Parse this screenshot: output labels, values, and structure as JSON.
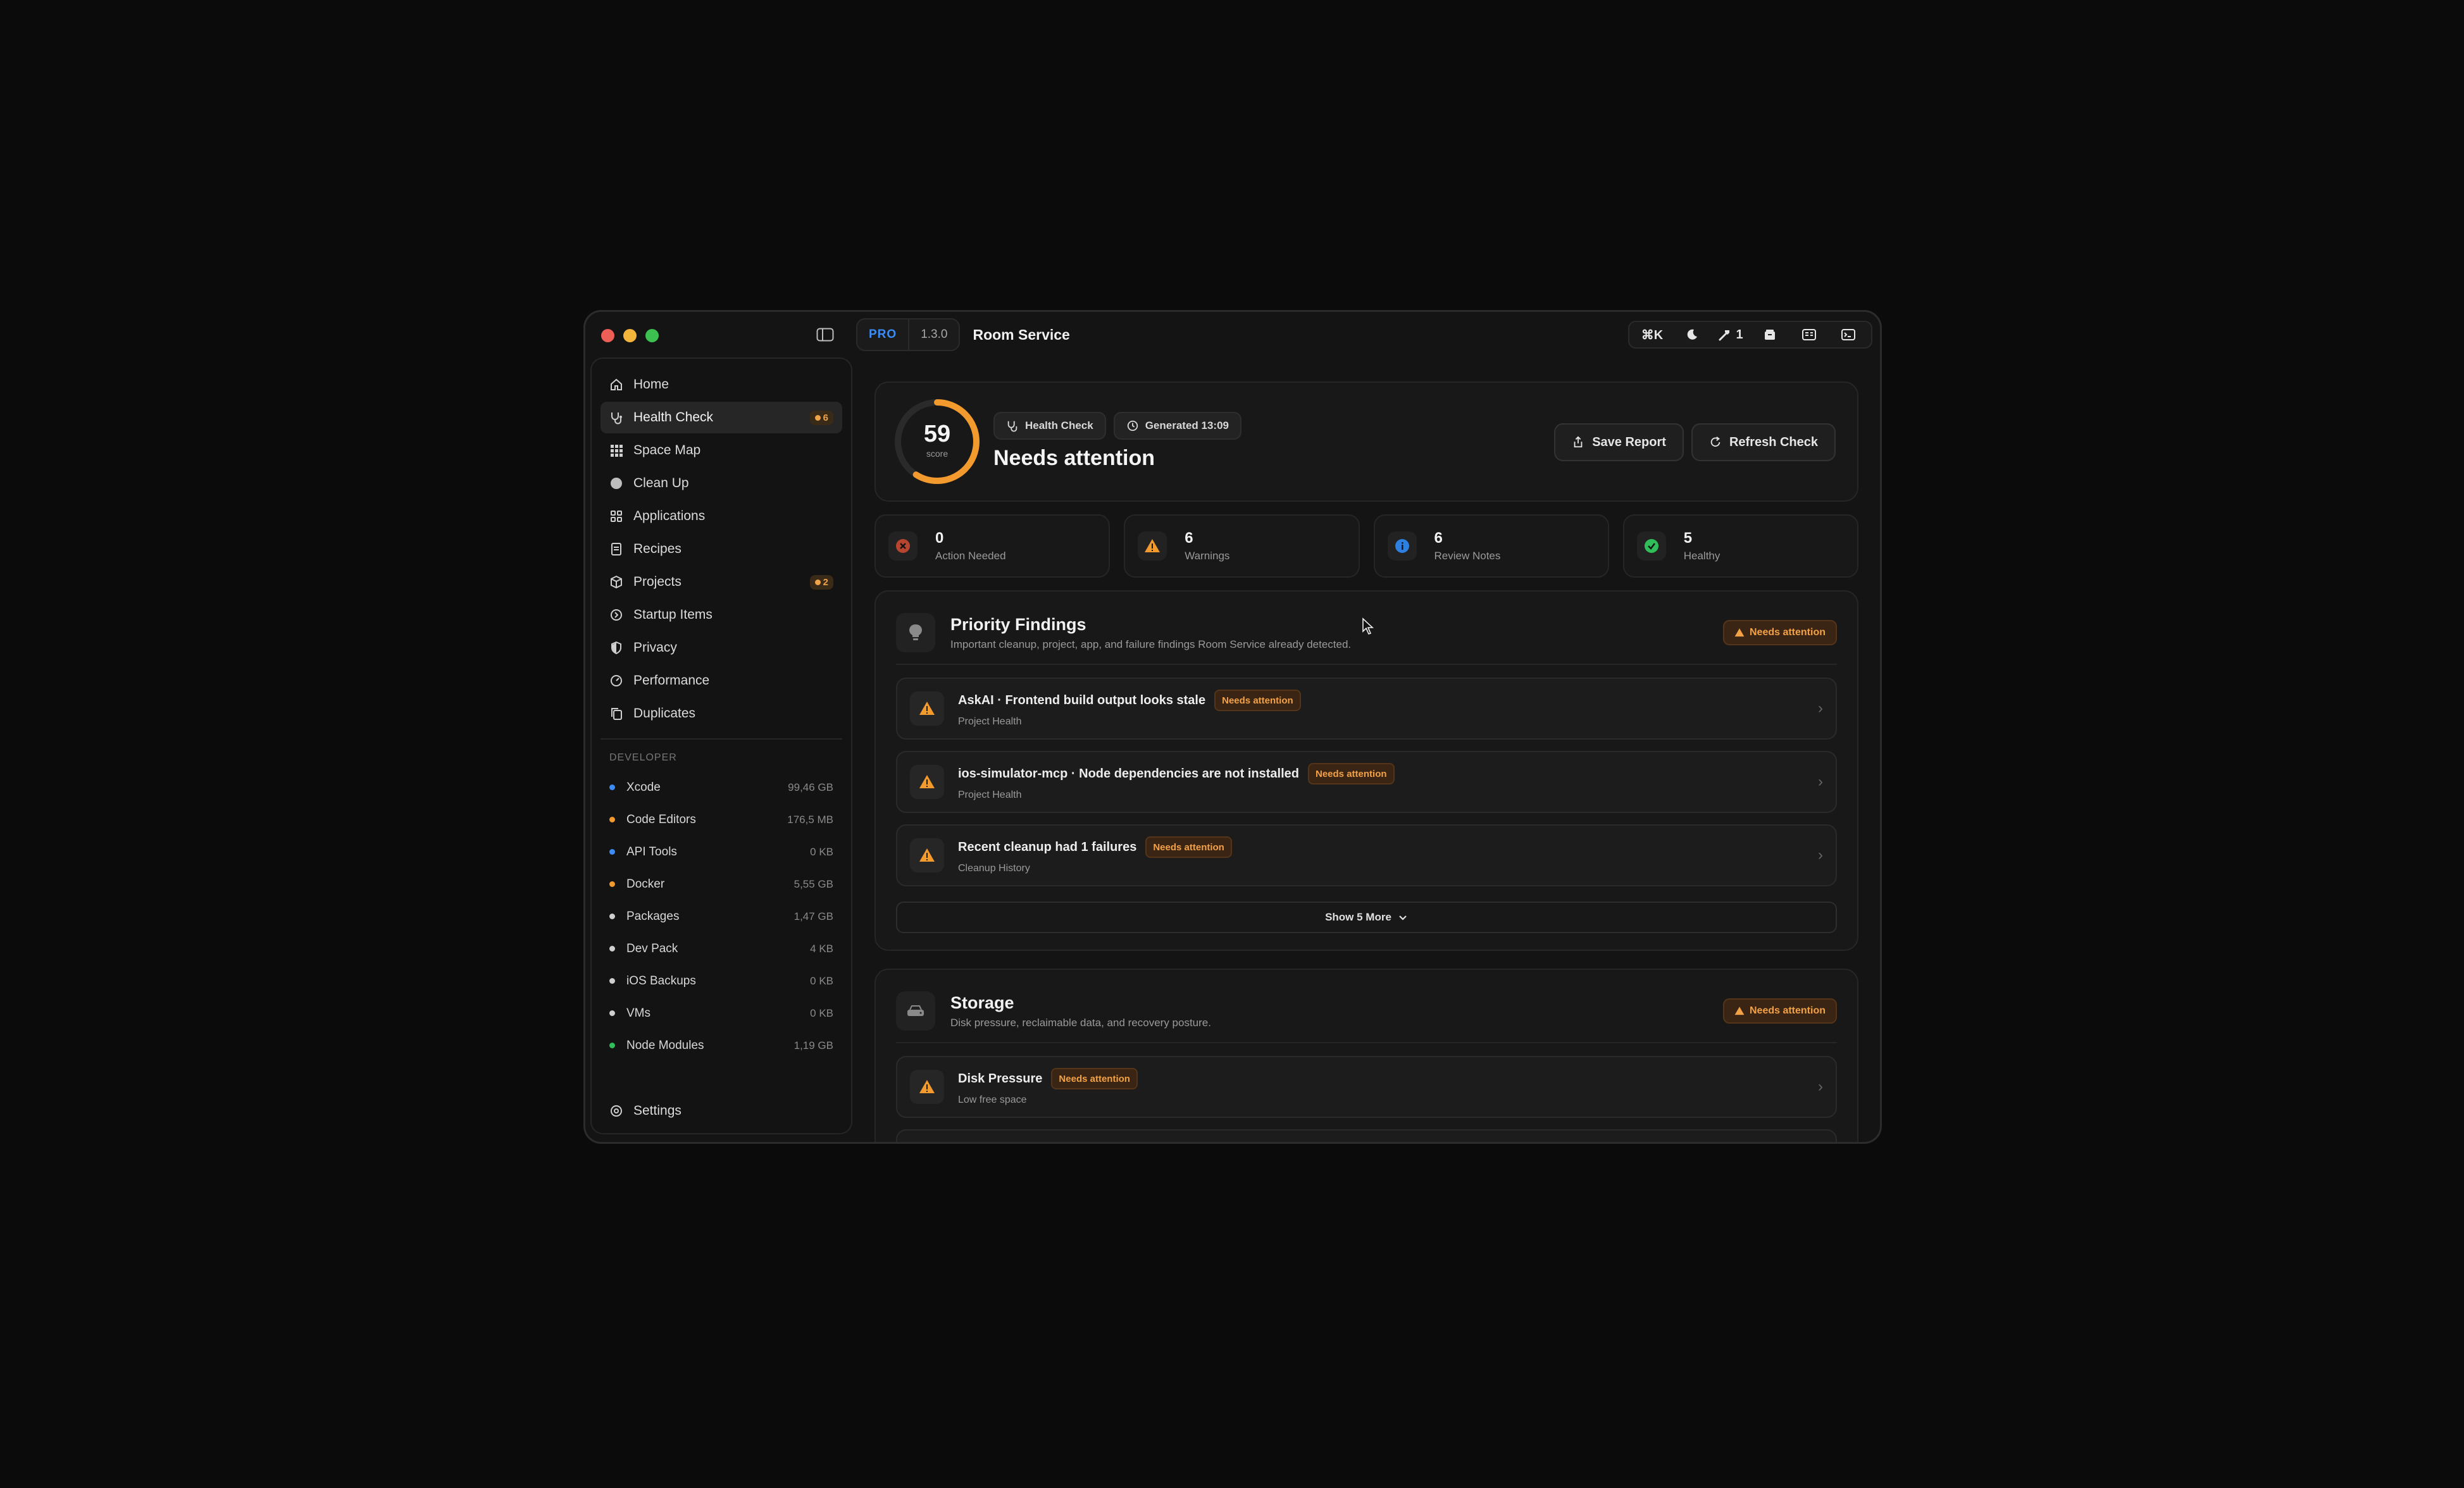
{
  "app": {
    "title": "Room Service",
    "plan": "PRO",
    "version": "1.3.0",
    "colors": {
      "accent": "#3b8df5",
      "warning": "#f29a2e",
      "danger": "#e0523b",
      "success": "#2fbe5a"
    }
  },
  "toolbar": {
    "command_key": "⌘K",
    "mode_icon": "moon-icon",
    "tasks_count": "1"
  },
  "sidebar": {
    "nav": [
      {
        "label": "Home",
        "icon": "home-icon"
      },
      {
        "label": "Health Check",
        "icon": "health-icon",
        "badge": "6",
        "active": true
      },
      {
        "label": "Space Map",
        "icon": "grid-icon"
      },
      {
        "label": "Clean Up",
        "icon": "circle-icon"
      },
      {
        "label": "Applications",
        "icon": "apps-icon"
      },
      {
        "label": "Recipes",
        "icon": "document-icon"
      },
      {
        "label": "Projects",
        "icon": "box-icon",
        "badge": "2"
      },
      {
        "label": "Startup Items",
        "icon": "power-icon"
      },
      {
        "label": "Privacy",
        "icon": "shield-icon"
      },
      {
        "label": "Performance",
        "icon": "gauge-icon"
      },
      {
        "label": "Duplicates",
        "icon": "copy-icon"
      }
    ],
    "developer_heading": "DEVELOPER",
    "developer": [
      {
        "label": "Xcode",
        "size": "99,46 GB",
        "color": "#3b8df5"
      },
      {
        "label": "Code Editors",
        "size": "176,5 MB",
        "color": "#f29a2e"
      },
      {
        "label": "API Tools",
        "size": "0 KB",
        "color": "#3b8df5"
      },
      {
        "label": "Docker",
        "size": "5,55 GB",
        "color": "#f29a2e"
      },
      {
        "label": "Packages",
        "size": "1,47 GB",
        "color": "#cfcfcf"
      },
      {
        "label": "Dev Pack",
        "size": "4 KB",
        "color": "#cfcfcf"
      },
      {
        "label": "iOS Backups",
        "size": "0 KB",
        "color": "#cfcfcf"
      },
      {
        "label": "VMs",
        "size": "0 KB",
        "color": "#cfcfcf"
      },
      {
        "label": "Node Modules",
        "size": "1,19 GB",
        "color": "#2fbe5a"
      }
    ],
    "settings_label": "Settings"
  },
  "hero": {
    "score": "59",
    "score_label": "score",
    "score_fraction": 0.59,
    "chip_health": "Health Check",
    "chip_generated": "Generated 13:09",
    "status": "Needs attention",
    "save_label": "Save Report",
    "refresh_label": "Refresh Check"
  },
  "stats": [
    {
      "value": "0",
      "label": "Action Needed",
      "icon": "x-circle-icon"
    },
    {
      "value": "6",
      "label": "Warnings",
      "icon": "warning-icon"
    },
    {
      "value": "6",
      "label": "Review Notes",
      "icon": "info-icon"
    },
    {
      "value": "5",
      "label": "Healthy",
      "icon": "check-badge-icon"
    }
  ],
  "priority": {
    "title": "Priority Findings",
    "subtitle": "Important cleanup, project, app, and failure findings Room Service already detected.",
    "status": "Needs attention",
    "findings": [
      {
        "title": "AskAI · Frontend build output looks stale",
        "tag": "Needs attention",
        "category": "Project Health"
      },
      {
        "title": "ios-simulator-mcp · Node dependencies are not installed",
        "tag": "Needs attention",
        "category": "Project Health"
      },
      {
        "title": "Recent cleanup had 1 failures",
        "tag": "Needs attention",
        "category": "Cleanup History"
      }
    ],
    "show_more": "Show 5 More"
  },
  "storage": {
    "title": "Storage",
    "subtitle": "Disk pressure, reclaimable data, and recovery posture.",
    "status": "Needs attention",
    "findings": [
      {
        "title": "Disk Pressure",
        "tag": "Needs attention",
        "category": "Low free space"
      }
    ]
  }
}
